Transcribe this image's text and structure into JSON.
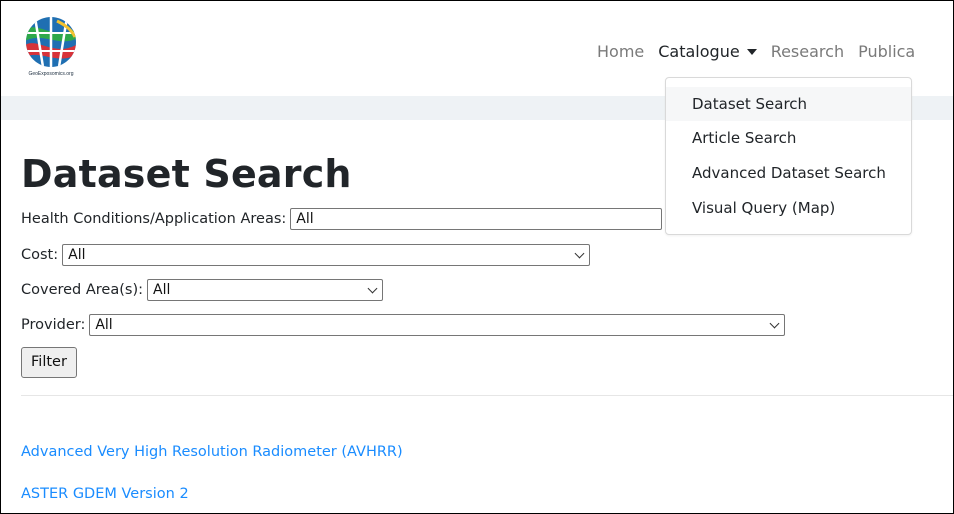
{
  "brand": {
    "logo_text": "GeoExposomics.org"
  },
  "nav": {
    "items": [
      {
        "label": "Home"
      },
      {
        "label": "Catalogue"
      },
      {
        "label": "Research"
      },
      {
        "label": "Publica"
      }
    ],
    "active": "Catalogue"
  },
  "dropdown": {
    "items": [
      {
        "label": "Dataset Search"
      },
      {
        "label": "Article Search"
      },
      {
        "label": "Advanced Dataset Search"
      },
      {
        "label": "Visual Query (Map)"
      }
    ]
  },
  "page": {
    "title": "Dataset Search"
  },
  "filters": {
    "health": {
      "label": "Health Conditions/Application Areas:",
      "value": "All"
    },
    "cost": {
      "label": "Cost:",
      "value": "All"
    },
    "area": {
      "label": "Covered Area(s):",
      "value": "All"
    },
    "provider": {
      "label": "Provider:",
      "value": "All"
    },
    "button_label": "Filter"
  },
  "datasets": [
    {
      "name": "Advanced Very High Resolution Radiometer (AVHRR)"
    },
    {
      "name": "ASTER GDEM Version 2"
    }
  ],
  "colors": {
    "link": "#1a8cff",
    "nav_muted": "#7a7a7a",
    "nav_band": "#eef2f5"
  }
}
